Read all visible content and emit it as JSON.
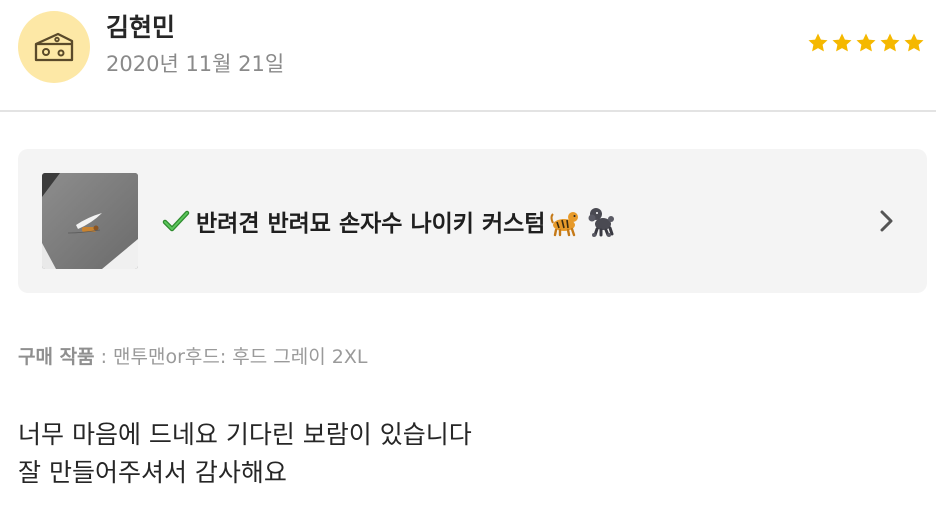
{
  "review": {
    "author": "김현민",
    "date": "2020년 11월 21일",
    "rating": {
      "value": 5,
      "max": 5,
      "color": "#f5b800"
    },
    "avatar_icon": "cheese-icon",
    "avatar_color": "#fde8a6"
  },
  "product": {
    "title": "반려견 반려묘 손자수 나이키 커스텀",
    "leading_icon": "check-mark-icon",
    "trailing_icons": [
      "tiger-icon",
      "poodle-icon"
    ],
    "chevron_icon": "chevron-right-icon",
    "card_color": "#f4f4f4"
  },
  "purchase": {
    "label": "구매 작품",
    "separator": " : ",
    "value": "맨투맨or후드: 후드 그레이 2XL"
  },
  "body": {
    "lines": [
      "너무 마음에 드네요 기다린 보람이 있습니다",
      "잘 만들어주셔서 감사해요"
    ]
  }
}
